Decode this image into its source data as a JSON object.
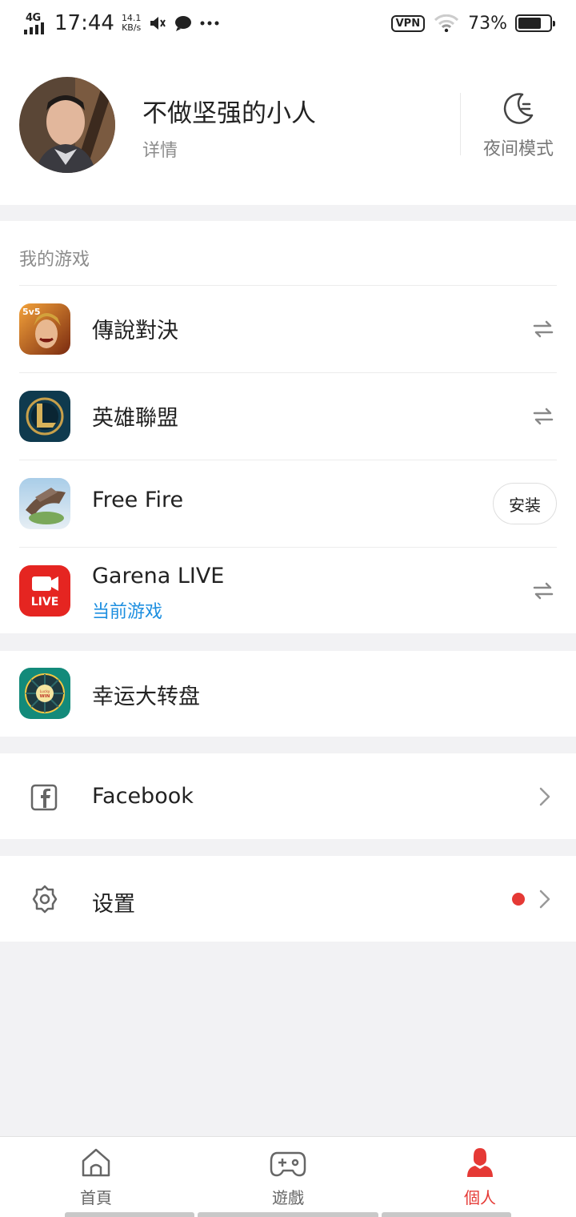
{
  "status_bar": {
    "network": "4G",
    "time": "17:44",
    "speed_value": "14.1",
    "speed_unit": "KB/s",
    "vpn": "VPN",
    "battery_percent": "73%",
    "battery_level": 0.73
  },
  "profile": {
    "username": "不做坚强的小人",
    "details_link": "详情",
    "night_mode_label": "夜间模式"
  },
  "my_games": {
    "title": "我的游戏",
    "games": [
      {
        "name": "傳說對決",
        "action": "switch"
      },
      {
        "name": "英雄聯盟",
        "action": "switch"
      },
      {
        "name": "Free Fire",
        "action": "install",
        "action_label": "安装"
      },
      {
        "name": "Garena LIVE",
        "subtitle": "当前游戏",
        "action": "switch"
      }
    ]
  },
  "lucky_wheel": {
    "label": "幸运大转盘",
    "icon_text": "Lucky WIN"
  },
  "facebook": {
    "label": "Facebook"
  },
  "settings": {
    "label": "设置",
    "has_notification_dot": true
  },
  "bottom_nav": {
    "tabs": [
      {
        "label": "首頁",
        "icon": "home-icon"
      },
      {
        "label": "遊戲",
        "icon": "gamepad-icon"
      },
      {
        "label": "個人",
        "icon": "person-icon",
        "active": true
      }
    ]
  },
  "colors": {
    "accent": "#e53935",
    "link_blue": "#1e8fe0",
    "background": "#f2f2f4"
  }
}
